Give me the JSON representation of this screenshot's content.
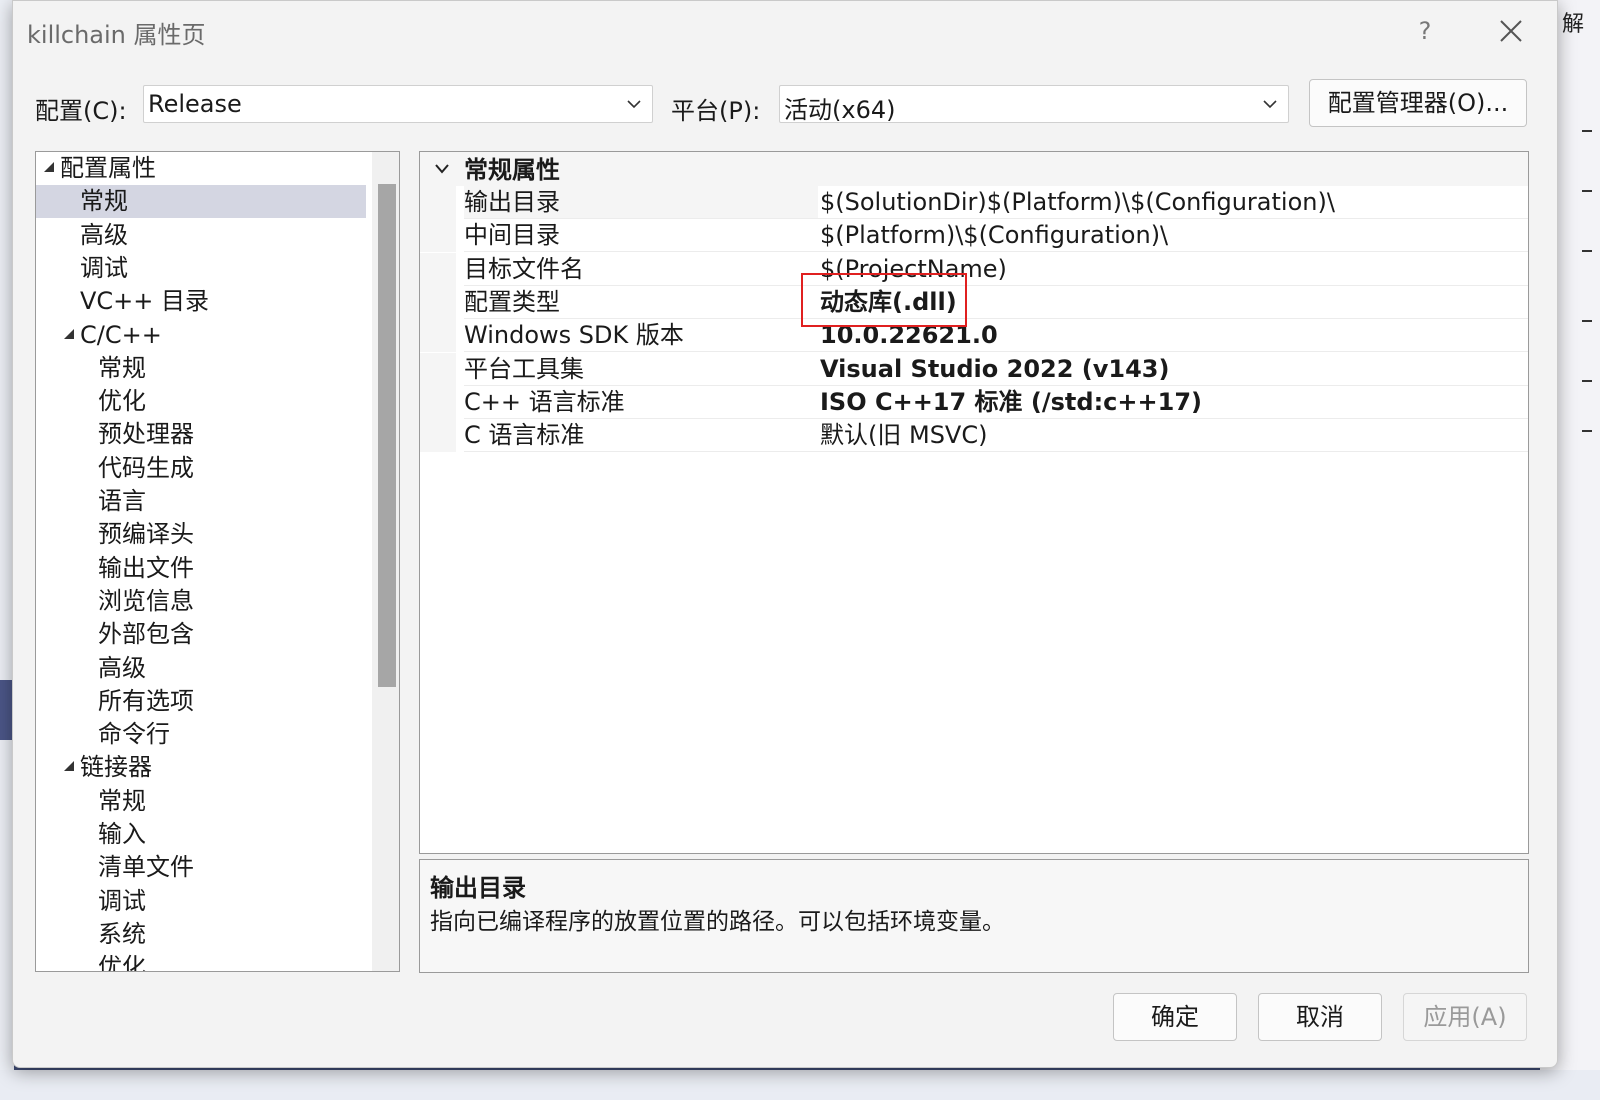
{
  "window": {
    "title": "killchain 属性页",
    "help_label": "?"
  },
  "config_bar": {
    "config_label": "配置(C):",
    "config_value": "Release",
    "platform_label": "平台(P):",
    "platform_value": "活动(x64)",
    "manager_button": "配置管理器(O)..."
  },
  "tree": {
    "items": [
      {
        "label": "配置属性",
        "level": 0,
        "expander": true
      },
      {
        "label": "常规",
        "level": 1,
        "selected": true
      },
      {
        "label": "高级",
        "level": 1
      },
      {
        "label": "调试",
        "level": 1
      },
      {
        "label": "VC++ 目录",
        "level": 1
      },
      {
        "label": "C/C++",
        "level": 1,
        "expander": true
      },
      {
        "label": "常规",
        "level": 2
      },
      {
        "label": "优化",
        "level": 2
      },
      {
        "label": "预处理器",
        "level": 2
      },
      {
        "label": "代码生成",
        "level": 2
      },
      {
        "label": "语言",
        "level": 2
      },
      {
        "label": "预编译头",
        "level": 2
      },
      {
        "label": "输出文件",
        "level": 2
      },
      {
        "label": "浏览信息",
        "level": 2
      },
      {
        "label": "外部包含",
        "level": 2
      },
      {
        "label": "高级",
        "level": 2
      },
      {
        "label": "所有选项",
        "level": 2
      },
      {
        "label": "命令行",
        "level": 2
      },
      {
        "label": "链接器",
        "level": 1,
        "expander": true
      },
      {
        "label": "常规",
        "level": 2
      },
      {
        "label": "输入",
        "level": 2
      },
      {
        "label": "清单文件",
        "level": 2
      },
      {
        "label": "调试",
        "level": 2
      },
      {
        "label": "系统",
        "level": 2
      },
      {
        "label": "优化",
        "level": 2
      }
    ]
  },
  "grid": {
    "category": "常规属性",
    "rows": [
      {
        "name": "输出目录",
        "value": "$(SolutionDir)$(Platform)\\$(Configuration)\\",
        "bold": false
      },
      {
        "name": "中间目录",
        "value": "$(Platform)\\$(Configuration)\\",
        "bold": false
      },
      {
        "name": "目标文件名",
        "value": "$(ProjectName)",
        "bold": false
      },
      {
        "name": "配置类型",
        "value": "动态库(.dll)",
        "bold": true
      },
      {
        "name": "Windows SDK 版本",
        "value": "10.0.22621.0",
        "bold": true
      },
      {
        "name": "平台工具集",
        "value": "Visual Studio 2022 (v143)",
        "bold": true
      },
      {
        "name": "C++ 语言标准",
        "value": "ISO C++17 标准 (/std:c++17)",
        "bold": true
      },
      {
        "name": "C 语言标准",
        "value": "默认(旧 MSVC)",
        "bold": false
      }
    ]
  },
  "description": {
    "title": "输出目录",
    "text": "指向已编译程序的放置位置的路径。可以包括环境变量。"
  },
  "buttons": {
    "ok": "确定",
    "cancel": "取消",
    "apply": "应用(A)"
  },
  "background": {
    "right_char": "解"
  },
  "colors": {
    "highlight_box": "#e02020",
    "selection": "#d4d6e2"
  }
}
